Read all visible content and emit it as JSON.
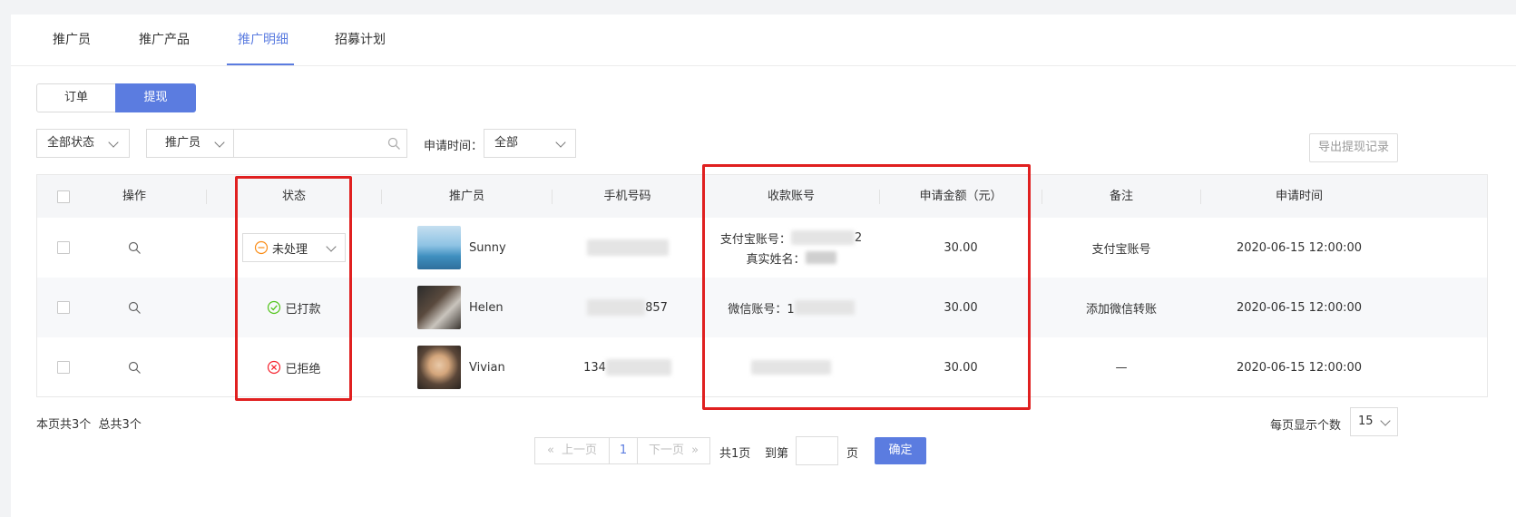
{
  "tabs": [
    {
      "label": "推广员"
    },
    {
      "label": "推广产品"
    },
    {
      "label": "推广明细"
    },
    {
      "label": "招募计划"
    }
  ],
  "segment": {
    "left": "订单",
    "right": "提现"
  },
  "filters": {
    "status": "全部状态",
    "promoter_type": "推广员",
    "search_value": "",
    "apply_time_label": "申请时间：",
    "apply_time_value": "全部",
    "export": "导出提现记录"
  },
  "table": {
    "headers": [
      "操作",
      "状态",
      "推广员",
      "手机号码",
      "收款账号",
      "申请金额（元）",
      "备注",
      "申请时间"
    ],
    "rows": [
      {
        "status": "未处理",
        "status_type": "pending",
        "promoter": "Sunny",
        "phone_visible": "",
        "account_line1_label": "支付宝账号：",
        "account_line1_tail": "2",
        "account_line2_label": "真实姓名：",
        "amount": "30.00",
        "remark": "支付宝账号",
        "time": "2020-06-15 12:00:00"
      },
      {
        "status": "已打款",
        "status_type": "paid",
        "promoter": "Helen",
        "phone_visible": "857",
        "account_line1_label": "微信账号：1",
        "amount": "30.00",
        "remark": "添加微信转账",
        "time": "2020-06-15 12:00:00"
      },
      {
        "status": "已拒绝",
        "status_type": "rejected",
        "promoter": "Vivian",
        "phone_visible": "134",
        "amount": "30.00",
        "remark": "—",
        "time": "2020-06-15 12:00:00"
      }
    ]
  },
  "footer": {
    "page_count_text": "本页共3个",
    "total_text": "总共3个",
    "per_page_label": "每页显示个数",
    "per_page_value": "15",
    "prev": "上一页",
    "current_page": "1",
    "next": "下一页",
    "total_pages": "共1页",
    "goto_label": "到第",
    "goto_suffix": "页",
    "confirm": "确定"
  },
  "colors": {
    "accent": "#5b7ce0",
    "highlight_box": "#e02020",
    "paid": "#52c41a",
    "rejected": "#f5222d",
    "pending": "#fa8c16"
  }
}
